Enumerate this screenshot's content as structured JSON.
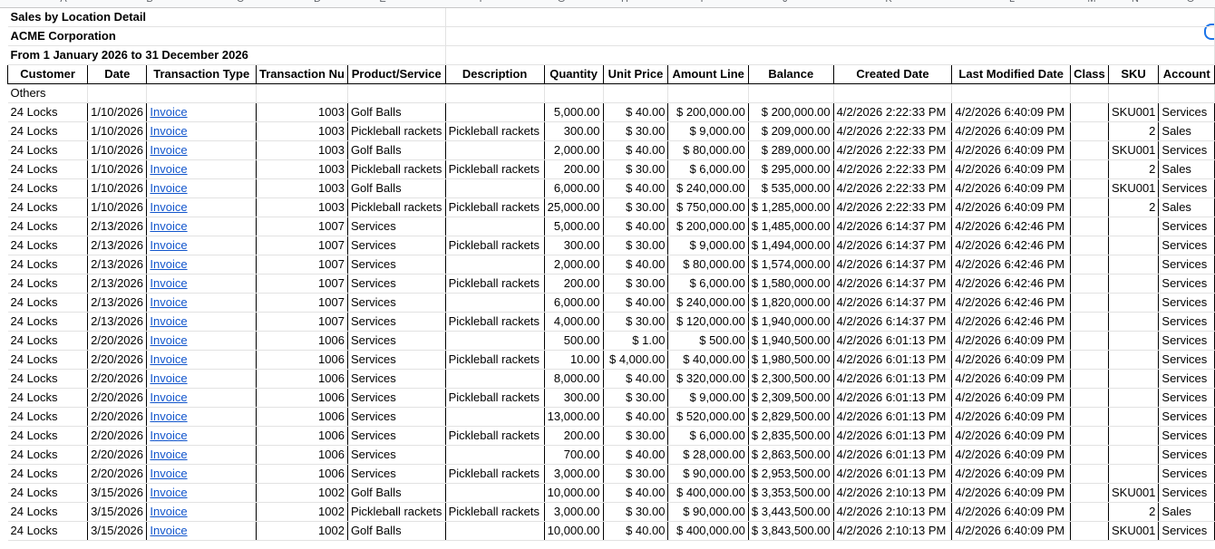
{
  "column_letters": [
    "A",
    "B",
    "C",
    "D",
    "E",
    "F",
    "G",
    "H",
    "I",
    "J",
    "K",
    "L",
    "M",
    "N",
    "O"
  ],
  "report": {
    "title": "Sales by Location Detail",
    "company": "ACME Corporation",
    "period": "From 1 January 2026 to 31 December 2026"
  },
  "headers": [
    "Customer",
    "Date",
    "Transaction Type",
    "Transaction Nu",
    "Product/Service",
    "Description",
    "Quantity",
    "Unit Price",
    "Amount Line",
    "Balance",
    "Created Date",
    "Last Modified Date",
    "Class",
    "SKU",
    "Account"
  ],
  "group_label": "Others",
  "rows": [
    [
      "24 Locks",
      "1/10/2026",
      "Invoice",
      "1003",
      "Golf Balls",
      "",
      "5,000.00",
      "$ 40.00",
      "$ 200,000.00",
      "$ 200,000.00",
      "4/2/2026 2:22:33 PM",
      "4/2/2026 6:40:09 PM",
      "",
      "SKU001",
      "Services"
    ],
    [
      "24 Locks",
      "1/10/2026",
      "Invoice",
      "1003",
      "Pickleball rackets",
      "Pickleball rackets",
      "300.00",
      "$ 30.00",
      "$ 9,000.00",
      "$ 209,000.00",
      "4/2/2026 2:22:33 PM",
      "4/2/2026 6:40:09 PM",
      "",
      "2",
      "Sales"
    ],
    [
      "24 Locks",
      "1/10/2026",
      "Invoice",
      "1003",
      "Golf Balls",
      "",
      "2,000.00",
      "$ 40.00",
      "$ 80,000.00",
      "$ 289,000.00",
      "4/2/2026 2:22:33 PM",
      "4/2/2026 6:40:09 PM",
      "",
      "SKU001",
      "Services"
    ],
    [
      "24 Locks",
      "1/10/2026",
      "Invoice",
      "1003",
      "Pickleball rackets",
      "Pickleball rackets",
      "200.00",
      "$ 30.00",
      "$ 6,000.00",
      "$ 295,000.00",
      "4/2/2026 2:22:33 PM",
      "4/2/2026 6:40:09 PM",
      "",
      "2",
      "Sales"
    ],
    [
      "24 Locks",
      "1/10/2026",
      "Invoice",
      "1003",
      "Golf Balls",
      "",
      "6,000.00",
      "$ 40.00",
      "$ 240,000.00",
      "$ 535,000.00",
      "4/2/2026 2:22:33 PM",
      "4/2/2026 6:40:09 PM",
      "",
      "SKU001",
      "Services"
    ],
    [
      "24 Locks",
      "1/10/2026",
      "Invoice",
      "1003",
      "Pickleball rackets",
      "Pickleball rackets",
      "25,000.00",
      "$ 30.00",
      "$ 750,000.00",
      "$ 1,285,000.00",
      "4/2/2026 2:22:33 PM",
      "4/2/2026 6:40:09 PM",
      "",
      "2",
      "Sales"
    ],
    [
      "24 Locks",
      "2/13/2026",
      "Invoice",
      "1007",
      "Services",
      "",
      "5,000.00",
      "$ 40.00",
      "$ 200,000.00",
      "$ 1,485,000.00",
      "4/2/2026 6:14:37 PM",
      "4/2/2026 6:42:46 PM",
      "",
      "",
      "Services"
    ],
    [
      "24 Locks",
      "2/13/2026",
      "Invoice",
      "1007",
      "Services",
      "Pickleball rackets",
      "300.00",
      "$ 30.00",
      "$ 9,000.00",
      "$ 1,494,000.00",
      "4/2/2026 6:14:37 PM",
      "4/2/2026 6:42:46 PM",
      "",
      "",
      "Services"
    ],
    [
      "24 Locks",
      "2/13/2026",
      "Invoice",
      "1007",
      "Services",
      "",
      "2,000.00",
      "$ 40.00",
      "$ 80,000.00",
      "$ 1,574,000.00",
      "4/2/2026 6:14:37 PM",
      "4/2/2026 6:42:46 PM",
      "",
      "",
      "Services"
    ],
    [
      "24 Locks",
      "2/13/2026",
      "Invoice",
      "1007",
      "Services",
      "Pickleball rackets",
      "200.00",
      "$ 30.00",
      "$ 6,000.00",
      "$ 1,580,000.00",
      "4/2/2026 6:14:37 PM",
      "4/2/2026 6:42:46 PM",
      "",
      "",
      "Services"
    ],
    [
      "24 Locks",
      "2/13/2026",
      "Invoice",
      "1007",
      "Services",
      "",
      "6,000.00",
      "$ 40.00",
      "$ 240,000.00",
      "$ 1,820,000.00",
      "4/2/2026 6:14:37 PM",
      "4/2/2026 6:42:46 PM",
      "",
      "",
      "Services"
    ],
    [
      "24 Locks",
      "2/13/2026",
      "Invoice",
      "1007",
      "Services",
      "Pickleball rackets",
      "4,000.00",
      "$ 30.00",
      "$ 120,000.00",
      "$ 1,940,000.00",
      "4/2/2026 6:14:37 PM",
      "4/2/2026 6:42:46 PM",
      "",
      "",
      "Services"
    ],
    [
      "24 Locks",
      "2/20/2026",
      "Invoice",
      "1006",
      "Services",
      "",
      "500.00",
      "$ 1.00",
      "$ 500.00",
      "$ 1,940,500.00",
      "4/2/2026 6:01:13 PM",
      "4/2/2026 6:40:09 PM",
      "",
      "",
      "Services"
    ],
    [
      "24 Locks",
      "2/20/2026",
      "Invoice",
      "1006",
      "Services",
      "Pickleball rackets",
      "10.00",
      "$ 4,000.00",
      "$ 40,000.00",
      "$ 1,980,500.00",
      "4/2/2026 6:01:13 PM",
      "4/2/2026 6:40:09 PM",
      "",
      "",
      "Services"
    ],
    [
      "24 Locks",
      "2/20/2026",
      "Invoice",
      "1006",
      "Services",
      "",
      "8,000.00",
      "$ 40.00",
      "$ 320,000.00",
      "$ 2,300,500.00",
      "4/2/2026 6:01:13 PM",
      "4/2/2026 6:40:09 PM",
      "",
      "",
      "Services"
    ],
    [
      "24 Locks",
      "2/20/2026",
      "Invoice",
      "1006",
      "Services",
      "Pickleball rackets",
      "300.00",
      "$ 30.00",
      "$ 9,000.00",
      "$ 2,309,500.00",
      "4/2/2026 6:01:13 PM",
      "4/2/2026 6:40:09 PM",
      "",
      "",
      "Services"
    ],
    [
      "24 Locks",
      "2/20/2026",
      "Invoice",
      "1006",
      "Services",
      "",
      "13,000.00",
      "$ 40.00",
      "$ 520,000.00",
      "$ 2,829,500.00",
      "4/2/2026 6:01:13 PM",
      "4/2/2026 6:40:09 PM",
      "",
      "",
      "Services"
    ],
    [
      "24 Locks",
      "2/20/2026",
      "Invoice",
      "1006",
      "Services",
      "Pickleball rackets",
      "200.00",
      "$ 30.00",
      "$ 6,000.00",
      "$ 2,835,500.00",
      "4/2/2026 6:01:13 PM",
      "4/2/2026 6:40:09 PM",
      "",
      "",
      "Services"
    ],
    [
      "24 Locks",
      "2/20/2026",
      "Invoice",
      "1006",
      "Services",
      "",
      "700.00",
      "$ 40.00",
      "$ 28,000.00",
      "$ 2,863,500.00",
      "4/2/2026 6:01:13 PM",
      "4/2/2026 6:40:09 PM",
      "",
      "",
      "Services"
    ],
    [
      "24 Locks",
      "2/20/2026",
      "Invoice",
      "1006",
      "Services",
      "Pickleball rackets",
      "3,000.00",
      "$ 30.00",
      "$ 90,000.00",
      "$ 2,953,500.00",
      "4/2/2026 6:01:13 PM",
      "4/2/2026 6:40:09 PM",
      "",
      "",
      "Services"
    ],
    [
      "24 Locks",
      "3/15/2026",
      "Invoice",
      "1002",
      "Golf Balls",
      "",
      "10,000.00",
      "$ 40.00",
      "$ 400,000.00",
      "$ 3,353,500.00",
      "4/2/2026 2:10:13 PM",
      "4/2/2026 6:40:09 PM",
      "",
      "SKU001",
      "Services"
    ],
    [
      "24 Locks",
      "3/15/2026",
      "Invoice",
      "1002",
      "Pickleball rackets",
      "Pickleball rackets",
      "3,000.00",
      "$ 30.00",
      "$ 90,000.00",
      "$ 3,443,500.00",
      "4/2/2026 2:10:13 PM",
      "4/2/2026 6:40:09 PM",
      "",
      "2",
      "Sales"
    ],
    [
      "24 Locks",
      "3/15/2026",
      "Invoice",
      "1002",
      "Golf Balls",
      "",
      "10,000.00",
      "$ 40.00",
      "$ 400,000.00",
      "$ 3,843,500.00",
      "4/2/2026 2:10:13 PM",
      "4/2/2026 6:40:09 PM",
      "",
      "SKU001",
      "Services"
    ]
  ]
}
